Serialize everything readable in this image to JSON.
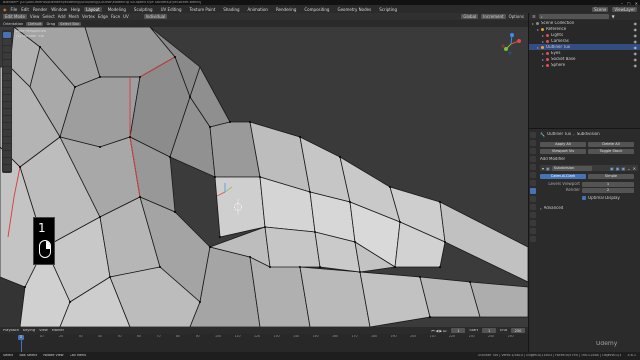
{
  "titlebar": {
    "title": "Blender* [D:\\Documents\\Blender\\Modeling\\Sculpting\\Course\\Modeling Sculpted Eye Sockets\\EyeSocket.blend]"
  },
  "menubar": {
    "items": [
      "File",
      "Edit",
      "Render",
      "Window",
      "Help"
    ],
    "tabs": [
      "Layout",
      "Modeling",
      "Sculpting",
      "UV Editing",
      "Texture Paint",
      "Shading",
      "Animation",
      "Rendering",
      "Compositing",
      "Geometry Nodes",
      "Scripting"
    ],
    "active_tab": "Layout",
    "scene": "Scene",
    "view_layer": "ViewLayer"
  },
  "header3d": {
    "mode": "Edit Mode",
    "items": [
      "View",
      "Select",
      "Add",
      "Mesh",
      "Vertex",
      "Edge",
      "Face",
      "UV"
    ],
    "orientation": "Global",
    "pivot": "Individual",
    "snap": "Increment",
    "options": "Options"
  },
  "toolheader": {
    "orientation": "Orientation",
    "default": "Default",
    "drag": "Drag",
    "select_box": "Select Box"
  },
  "viewport": {
    "overlay_title": "User Perspective",
    "overlay_sub": "(1) Outliner Tux",
    "key_number": "1",
    "accent_colors": {
      "selected_vertex": "#ff8a1c",
      "active": "#ffffff",
      "seam": "#d83c3c"
    }
  },
  "outliner": {
    "title": "Scene Collection",
    "rows": [
      {
        "label": "Scene Collection",
        "depth": 0,
        "selected": false,
        "color": "#8a8a8a"
      },
      {
        "label": "Reference",
        "depth": 1,
        "selected": false,
        "color": "#e0a030"
      },
      {
        "label": "Lights",
        "depth": 2,
        "selected": false,
        "color": "#e05050"
      },
      {
        "label": "Cameras",
        "depth": 2,
        "selected": false,
        "color": "#e05050"
      },
      {
        "label": "Outliner Tux",
        "depth": 1,
        "selected": true,
        "color": "#ff9a28"
      },
      {
        "label": "Eyes",
        "depth": 2,
        "selected": false,
        "color": "#e05050"
      },
      {
        "label": "Socket Base",
        "depth": 2,
        "selected": false,
        "color": "#e05050"
      },
      {
        "label": "Sphere",
        "depth": 2,
        "selected": false,
        "color": "#e05050"
      }
    ]
  },
  "properties": {
    "object_name": "Outliner Tux",
    "modifier_tab": "Subdivision",
    "apply_all": "Apply All",
    "delete_all": "Delete All",
    "viewport_vis": "Viewport Vis",
    "toggle_stack": "Toggle Stack",
    "add_modifier": "Add Modifier",
    "modifier_name": "Subdivision",
    "catmull": "Catmull-Clark",
    "simple": "Simple",
    "levels_viewport_label": "Levels Viewport",
    "levels_viewport": "1",
    "render_label": "Render",
    "render": "2",
    "optimal_display": "Optimal Display",
    "advanced": "Advanced"
  },
  "timeline": {
    "items": [
      "Playback",
      "Keying",
      "View",
      "Marker"
    ],
    "current_frame": "1",
    "start_label": "Start",
    "start": "1",
    "end_label": "End",
    "end": "250",
    "ticks": [
      "0",
      "10",
      "20",
      "30",
      "40",
      "50",
      "60",
      "70",
      "80",
      "90",
      "100",
      "110",
      "120",
      "130",
      "140",
      "150",
      "160",
      "170",
      "180",
      "190",
      "200",
      "210",
      "220",
      "230",
      "240",
      "250"
    ]
  },
  "statusbar": {
    "items": [
      "Select",
      "Box Select",
      "Rotate View",
      "Call Menu"
    ],
    "stats": "Outliner Tux | Verts:1/5810 | Edges:0/11603 | Faces:0/5794 | Tris:11588 | Objects:1/3",
    "version": "3.6.1"
  },
  "watermark": "Udemy"
}
